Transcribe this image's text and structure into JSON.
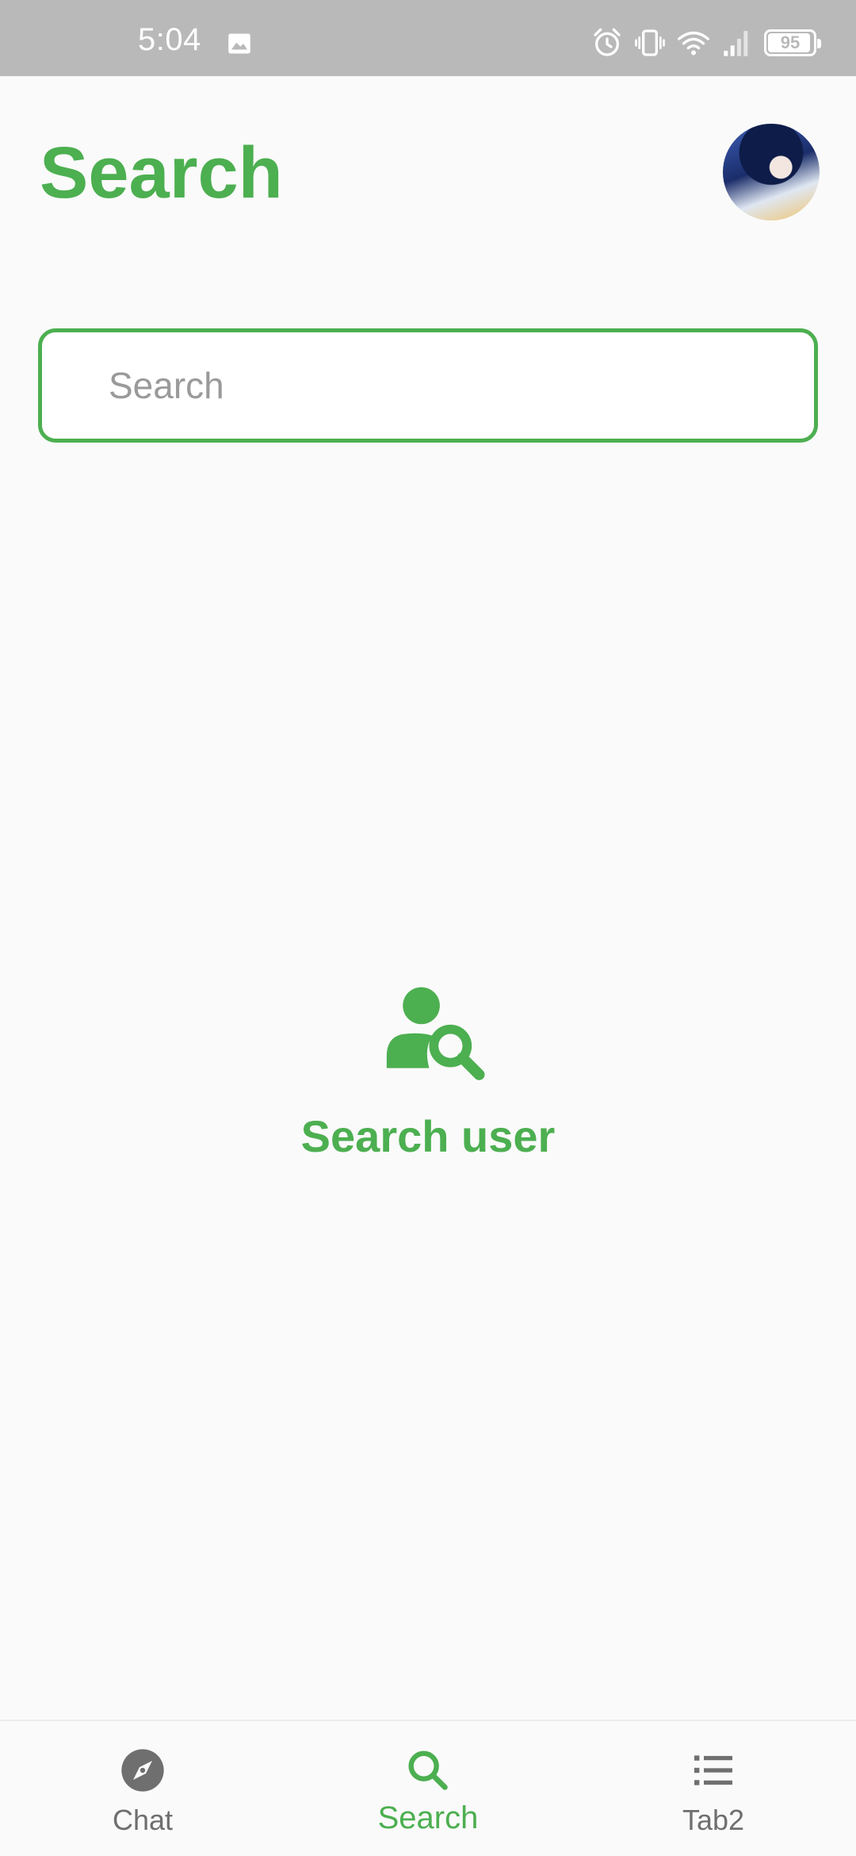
{
  "status_bar": {
    "time": "5:04",
    "battery": "95",
    "battery_level": 0.95,
    "icons": [
      "gallery-icon",
      "alarm-icon",
      "vibrate-icon",
      "wifi-icon",
      "signal-icon",
      "battery-icon"
    ]
  },
  "header": {
    "title": "Search"
  },
  "search": {
    "value": "",
    "placeholder": "Search"
  },
  "empty_state": {
    "icon": "person-search-icon",
    "label": "Search user"
  },
  "bottom_nav": {
    "items": [
      {
        "label": "Chat",
        "icon": "compass-icon",
        "active": false
      },
      {
        "label": "Search",
        "icon": "search-icon",
        "active": true
      },
      {
        "label": "Tab2",
        "icon": "list-icon",
        "active": false
      }
    ]
  },
  "colors": {
    "accent": "#4caf50",
    "status_bar": "#b9b9b9",
    "background": "#fafafa",
    "inactive": "#6f6f6f"
  }
}
